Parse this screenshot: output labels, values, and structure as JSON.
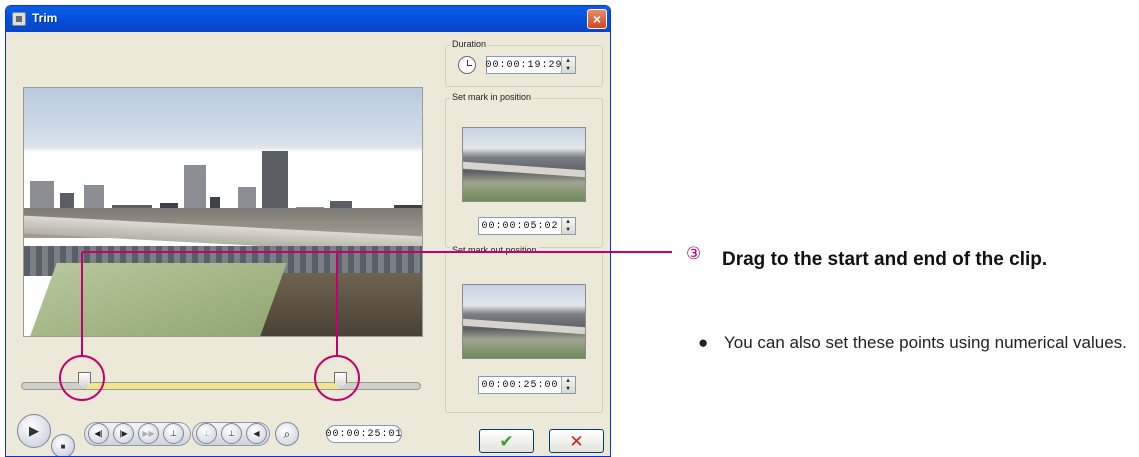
{
  "window": {
    "title": "Trim",
    "close_label": "×"
  },
  "panel": {
    "duration": {
      "label": "Duration",
      "value": "00:00:19:29"
    },
    "mark_in": {
      "label": "Set mark in position",
      "value": "00:00:05:02"
    },
    "mark_out": {
      "label": "Set mark out position",
      "value": "00:00:25:00"
    }
  },
  "timeline": {
    "range_start_fraction": 0.16,
    "range_end_fraction": 0.8
  },
  "controls": {
    "current_time": "00:00:25:01",
    "play_glyph": "▶",
    "stop_glyph": "■",
    "buttons": [
      {
        "name": "prev-frame",
        "glyph": "◀|"
      },
      {
        "name": "next-frame",
        "glyph": "|▶"
      },
      {
        "name": "fast-forward",
        "glyph": "▶▶"
      },
      {
        "name": "mark-in",
        "glyph": "⊥"
      },
      {
        "name": "go-mark-in",
        "glyph": "⊥"
      },
      {
        "name": "go-mark-out",
        "glyph": "⊥"
      },
      {
        "name": "mute",
        "glyph": "◀"
      }
    ],
    "zoom_glyph": "⌕",
    "ok_glyph": "✔",
    "cancel_glyph": "✕"
  },
  "annotation": {
    "step_number": "③",
    "step_text": "Drag to the start and end of the clip.",
    "bullet_symbol": "●",
    "bullet_text": "You can also set these points using numerical values."
  },
  "colors": {
    "accent": "#c2006f",
    "titlebar": "#0a5fe6",
    "timeline_range": "#f2e58e",
    "ok_check": "#38a22b",
    "cancel_x": "#cc1f1f"
  }
}
